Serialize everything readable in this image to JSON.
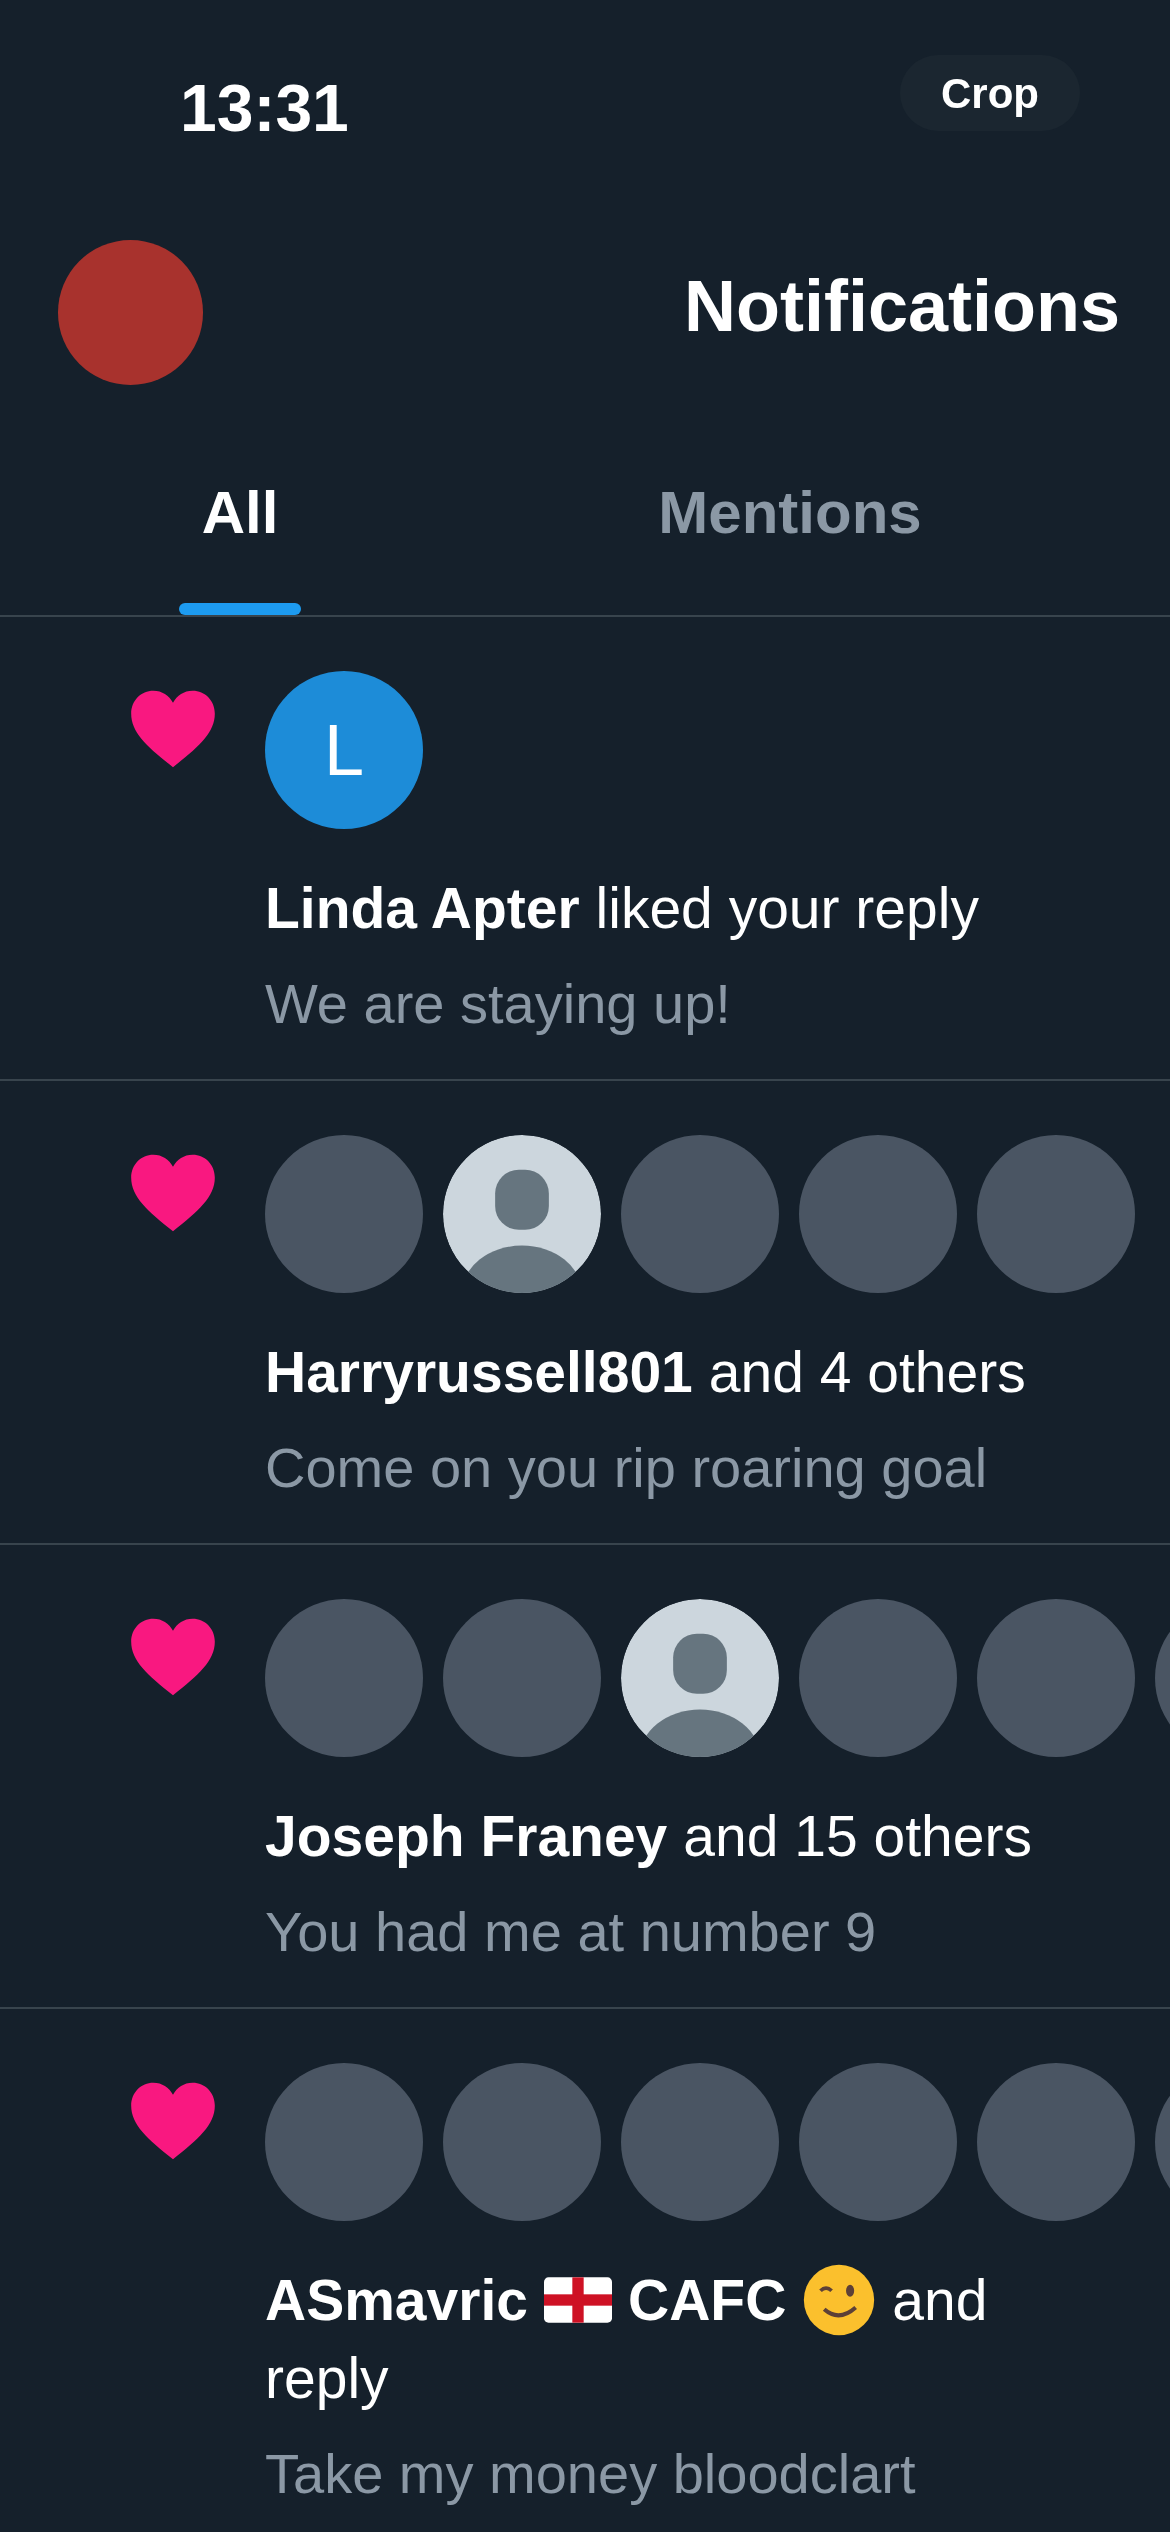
{
  "status_bar": {
    "time": "13:31",
    "crop_button": "Crop"
  },
  "header": {
    "title": "Notifications"
  },
  "tabs": [
    {
      "label": "All",
      "selected": true
    },
    {
      "label": "Mentions",
      "selected": false
    }
  ],
  "notifications": [
    {
      "avatars": [
        {
          "kind": "letter",
          "letter": "L"
        }
      ],
      "title": [
        {
          "kind": "name",
          "text": "Linda Apter"
        },
        {
          "kind": "text",
          "text": "liked your reply"
        }
      ],
      "body": "We are staying up!"
    },
    {
      "avatars": [
        {
          "kind": "photo"
        },
        {
          "kind": "default"
        },
        {
          "kind": "photo"
        },
        {
          "kind": "photo"
        },
        {
          "kind": "photo"
        }
      ],
      "title": [
        {
          "kind": "name",
          "text": "Harryrussell801"
        },
        {
          "kind": "text",
          "text": "and 4 others"
        }
      ],
      "body": "Come on you rip roaring goal"
    },
    {
      "avatars": [
        {
          "kind": "photo"
        },
        {
          "kind": "photo"
        },
        {
          "kind": "default"
        },
        {
          "kind": "photo"
        },
        {
          "kind": "photo"
        },
        {
          "kind": "photo"
        }
      ],
      "title": [
        {
          "kind": "name",
          "text": "Joseph Franey"
        },
        {
          "kind": "text",
          "text": "and 15 others"
        }
      ],
      "body": "You had me at number 9"
    },
    {
      "avatars": [
        {
          "kind": "photo"
        },
        {
          "kind": "photo"
        },
        {
          "kind": "photo"
        },
        {
          "kind": "photo"
        },
        {
          "kind": "photo"
        },
        {
          "kind": "photo"
        }
      ],
      "title": [
        {
          "kind": "name",
          "text": "ASmavric"
        },
        {
          "kind": "flag"
        },
        {
          "kind": "name",
          "text": "CAFC"
        },
        {
          "kind": "wink"
        },
        {
          "kind": "text",
          "text": "and"
        }
      ],
      "second_line": "reply",
      "body": "Take my money bloodclart"
    }
  ]
}
